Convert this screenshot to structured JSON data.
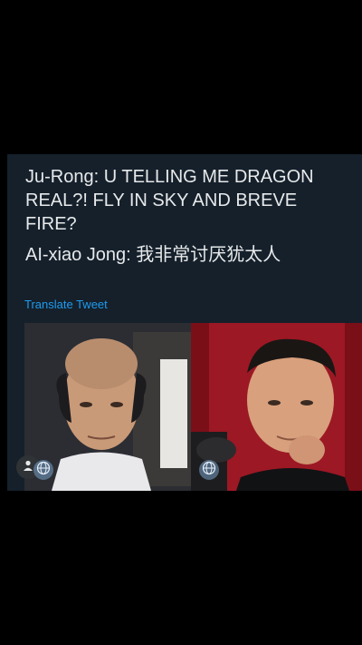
{
  "tweet": {
    "line1": "Ju-Rong: U TELLING ME DRAGON REAL?! FLY IN SKY AND BREVE FIRE?",
    "line2": "AI-xiao Jong: 我非常讨厌犹太人",
    "translate_label": "Translate Tweet"
  },
  "icons": {
    "profile": "person-icon",
    "globe": "globe-icon"
  },
  "colors": {
    "background": "#000000",
    "card": "#15202b",
    "text": "#e7e9ea",
    "link": "#1d9bf0"
  }
}
